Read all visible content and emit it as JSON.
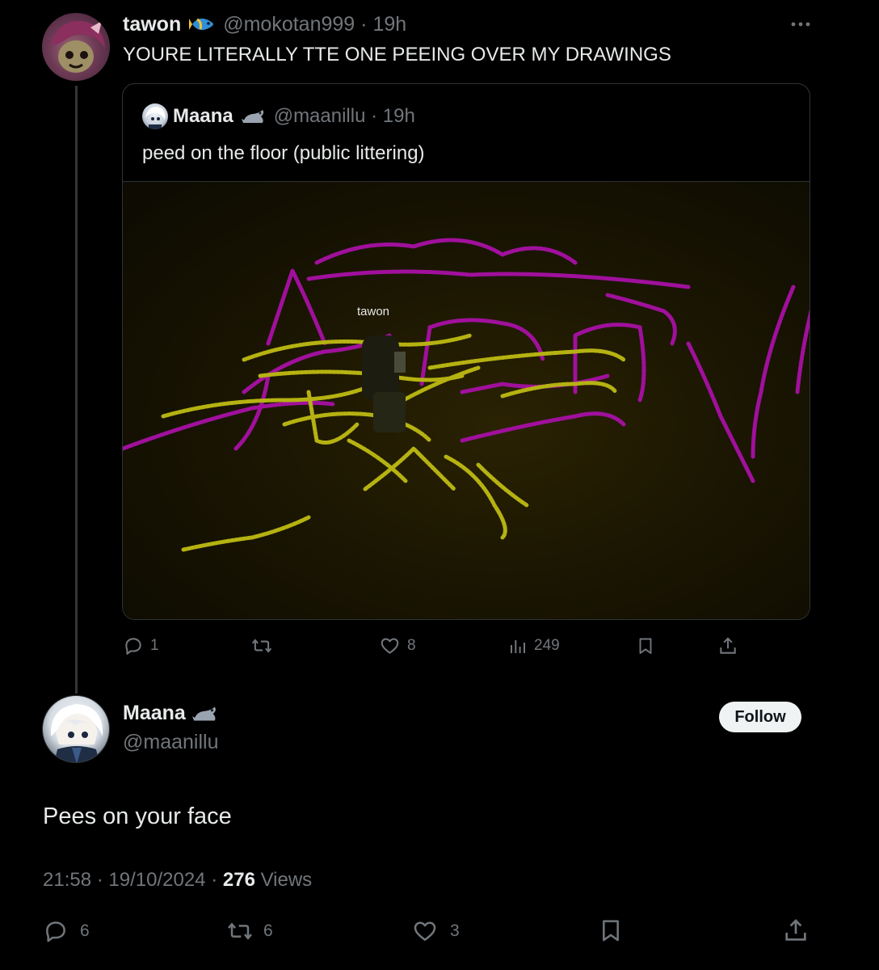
{
  "parent_tweet": {
    "author_name": "tawon",
    "author_emoji": "tropical-fish-icon",
    "handle": "@mokotan999",
    "separator": "·",
    "time": "19h",
    "text": "YOURE LITERALLY TTE ONE PEEING OVER MY DRAWINGS",
    "actions": {
      "replies": "1",
      "reposts": "",
      "likes": "8",
      "views": "249"
    }
  },
  "quoted_tweet": {
    "author_name": "Maana",
    "author_emoji": "seal-icon",
    "handle": "@maanillu",
    "separator": "·",
    "time": "19h",
    "text": "peed on the floor (public littering)",
    "media": {
      "player_name_tag": "tawon",
      "colors": {
        "floor": "#1b1602",
        "magenta_drawing": "#a0109c",
        "yellow_drawing": "#b5b212"
      }
    }
  },
  "main_tweet": {
    "author_name": "Maana",
    "author_emoji": "seal-icon",
    "handle": "@maanillu",
    "follow_label": "Follow",
    "text": "Pees on your face",
    "time": "21:58",
    "date": "19/10/2024",
    "separator": "·",
    "views_count": "276",
    "views_label": "Views",
    "actions": {
      "replies": "6",
      "reposts": "6",
      "likes": "3"
    }
  },
  "colors": {
    "background": "#000000",
    "text_primary": "#e7e9ea",
    "text_muted": "#71767b",
    "border": "#2f3336",
    "follow_button_bg": "#eff3f4"
  }
}
